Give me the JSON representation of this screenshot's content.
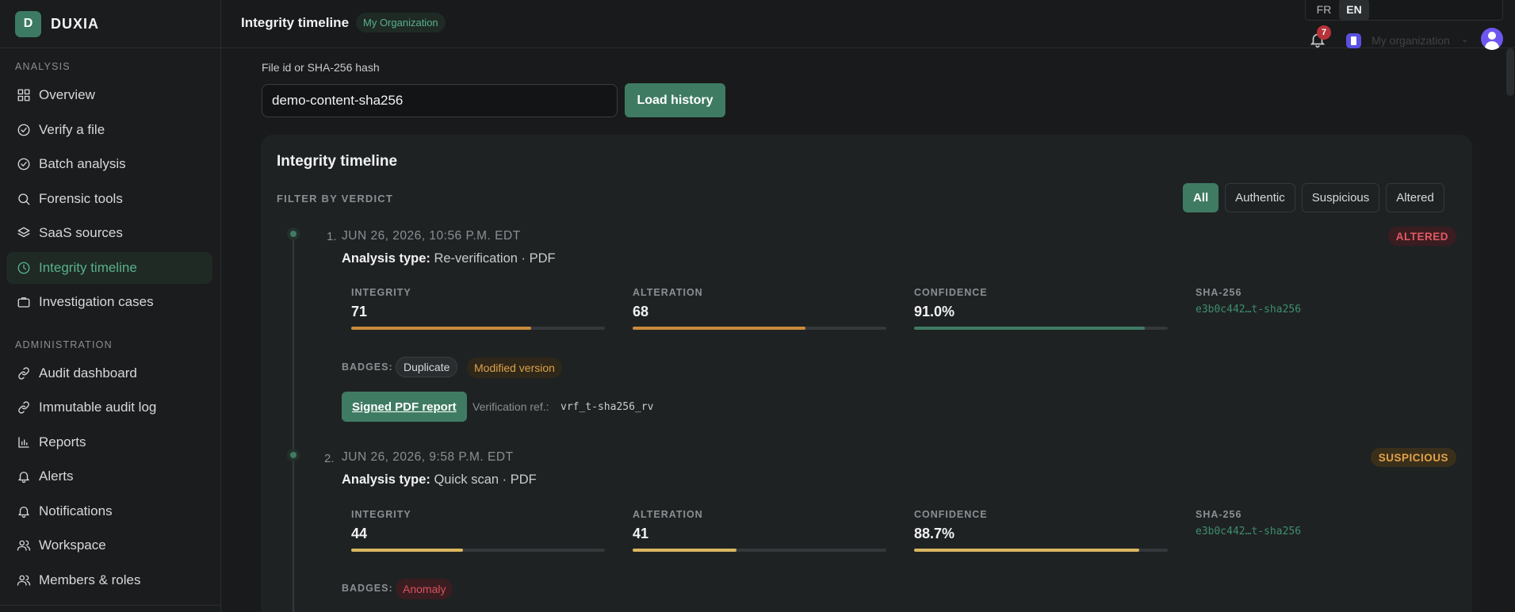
{
  "brand": {
    "logo_letter": "D",
    "name": "DUXIA"
  },
  "sidebar": {
    "analysis_label": "ANALYSIS",
    "analysis_items": [
      {
        "label": "Overview",
        "icon": "grid-icon"
      },
      {
        "label": "Verify a file",
        "icon": "check-circle-icon"
      },
      {
        "label": "Batch analysis",
        "icon": "check-circle-icon"
      },
      {
        "label": "Forensic tools",
        "icon": "search-icon"
      },
      {
        "label": "SaaS sources",
        "icon": "layers-icon"
      },
      {
        "label": "Integrity timeline",
        "icon": "clock-icon",
        "active": true
      },
      {
        "label": "Investigation cases",
        "icon": "briefcase-icon"
      }
    ],
    "admin_label": "ADMINISTRATION",
    "admin_items": [
      {
        "label": "Audit dashboard",
        "icon": "link-icon"
      },
      {
        "label": "Immutable audit log",
        "icon": "link-icon"
      },
      {
        "label": "Reports",
        "icon": "bar-chart-icon"
      },
      {
        "label": "Alerts",
        "icon": "bell-icon"
      },
      {
        "label": "Notifications",
        "icon": "bell-icon"
      },
      {
        "label": "Workspace",
        "icon": "users-icon"
      },
      {
        "label": "Members & roles",
        "icon": "users-icon"
      }
    ]
  },
  "topbar": {
    "title": "Integrity timeline",
    "org_pill": "My Organization",
    "languages": [
      "FR",
      "EN"
    ],
    "active_language": "EN",
    "notification_count": "7",
    "org_select": "My organization"
  },
  "search": {
    "label": "File id or SHA-256 hash",
    "value": "demo-content-sha256",
    "button": "Load history"
  },
  "timeline": {
    "title": "Integrity timeline",
    "filter_label": "FILTER BY VERDICT",
    "filters": [
      "All",
      "Authentic",
      "Suspicious",
      "Altered"
    ],
    "active_filter": "All",
    "metric_labels": {
      "integrity": "INTEGRITY",
      "alteration": "ALTERATION",
      "confidence": "CONFIDENCE",
      "sha": "SHA-256"
    },
    "badges_label": "BADGES:",
    "type_prefix": "Analysis type:",
    "entries": [
      {
        "index": "1.",
        "date": "JUN 26, 2026, 10:56 P.M. EDT",
        "analysis_type": "Re-verification · PDF",
        "verdict": "ALTERED",
        "integrity": "71",
        "integrity_fraction": 0.71,
        "alteration": "68",
        "alteration_fraction": 0.68,
        "confidence": "91.0%",
        "confidence_fraction": 0.91,
        "sha": "e3b0c442…t-sha256",
        "bar_color": "#c98a3d",
        "confidence_color": "#3f7b63",
        "badges": [
          "Duplicate",
          "Modified version"
        ],
        "report_button": "Signed PDF report",
        "ref_label": "Verification ref.:",
        "ref_value": "vrf_t-sha256_rv"
      },
      {
        "index": "2.",
        "date": "JUN 26, 2026, 9:58 P.M. EDT",
        "analysis_type": "Quick scan · PDF",
        "verdict": "SUSPICIOUS",
        "integrity": "44",
        "integrity_fraction": 0.44,
        "alteration": "41",
        "alteration_fraction": 0.41,
        "confidence": "88.7%",
        "confidence_fraction": 0.887,
        "sha": "e3b0c442…t-sha256",
        "bar_color": "#d9b760",
        "confidence_color": "#d9b760",
        "badges": [
          "Anomaly"
        ]
      }
    ]
  }
}
